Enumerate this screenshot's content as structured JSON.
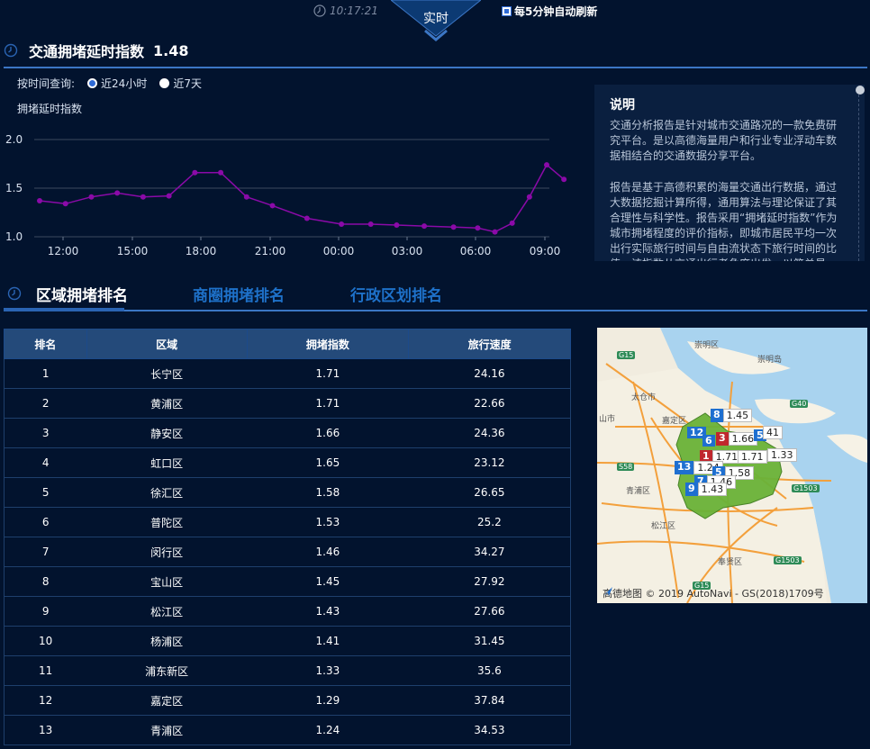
{
  "topbar": {
    "time": "10:17:21",
    "realtime_tab": "实时",
    "auto_refresh": "每5分钟自动刷新"
  },
  "index": {
    "title": "交通拥堵延时指数",
    "value": "1.48",
    "query_label": "按时间查询:",
    "options": [
      "近24小时",
      "近7天"
    ],
    "selected_option": "近24小时",
    "ylabel": "拥堵延时指数"
  },
  "chart_data": {
    "type": "line",
    "ylabel": "拥堵延时指数",
    "ylim": [
      1.0,
      2.0
    ],
    "yticks": [
      "2.0",
      "1.5",
      "1.0"
    ],
    "xticks": [
      "12:00",
      "15:00",
      "18:00",
      "21:00",
      "00:00",
      "03:00",
      "06:00",
      "09:00"
    ],
    "color": "#8b0aa8",
    "grid": true,
    "x_hours_from_start": [
      0,
      1.5,
      3,
      4.5,
      6,
      7.5,
      9,
      10.5,
      12,
      13.5,
      15.5,
      17.5,
      19.2,
      20.7,
      22.3,
      24,
      25.4,
      26.4,
      27.4,
      28.4,
      29.4,
      30.4
    ],
    "values": [
      1.37,
      1.34,
      1.41,
      1.45,
      1.41,
      1.42,
      1.66,
      1.66,
      1.41,
      1.32,
      1.19,
      1.13,
      1.13,
      1.12,
      1.11,
      1.1,
      1.09,
      1.05,
      1.14,
      1.41,
      1.74,
      1.59
    ]
  },
  "description": {
    "title": "说明",
    "p1": "交通分析报告是针对城市交通路况的一款免费研究平台。是以高德海量用户和行业专业浮动车数据相结合的交通数据分享平台。",
    "p2": "报告是基于高德积累的海量交通出行数据，通过大数据挖掘计算所得，通用算法与理论保证了其合理性与科学性。报告采用“拥堵延时指数”作为城市拥堵程度的评价指标，即城市居民平均一次出行实际旅行时间与自由流状态下旅行时间的比值。该指数从交通出行者角度出发，以简单易"
  },
  "tabs": [
    "区域拥堵排名",
    "商圈拥堵排名",
    "行政区划排名"
  ],
  "table": {
    "headers": [
      "排名",
      "区域",
      "拥堵指数",
      "旅行速度"
    ],
    "rows": [
      [
        "1",
        "长宁区",
        "1.71",
        "24.16"
      ],
      [
        "2",
        "黄浦区",
        "1.71",
        "22.66"
      ],
      [
        "3",
        "静安区",
        "1.66",
        "24.36"
      ],
      [
        "4",
        "虹口区",
        "1.65",
        "23.12"
      ],
      [
        "5",
        "徐汇区",
        "1.58",
        "26.65"
      ],
      [
        "6",
        "普陀区",
        "1.53",
        "25.2"
      ],
      [
        "7",
        "闵行区",
        "1.46",
        "34.27"
      ],
      [
        "8",
        "宝山区",
        "1.45",
        "27.92"
      ],
      [
        "9",
        "松江区",
        "1.43",
        "27.66"
      ],
      [
        "10",
        "杨浦区",
        "1.41",
        "31.45"
      ],
      [
        "11",
        "浦东新区",
        "1.33",
        "35.6"
      ],
      [
        "12",
        "嘉定区",
        "1.29",
        "37.84"
      ],
      [
        "13",
        "青浦区",
        "1.24",
        "34.53"
      ]
    ]
  },
  "map": {
    "place_labels": [
      "崇明区",
      "崇明岛",
      "太仓市",
      "嘉定区",
      "青浦区",
      "松江区",
      "奉贤区",
      "山市"
    ],
    "road_labels": [
      "G15",
      "G40",
      "S58",
      "G1503",
      "G1503",
      "G15"
    ],
    "markers": [
      {
        "n": "8",
        "v": "1.45",
        "red": false
      },
      {
        "n": "12",
        "v": "",
        "red": false
      },
      {
        "n": "6",
        "v": "",
        "red": false
      },
      {
        "n": "3",
        "v": "1.66",
        "red": true
      },
      {
        "n": "5",
        "v": "",
        "red": false
      },
      {
        "n": "",
        "v": "41",
        "red": false
      },
      {
        "n": "1",
        "v": "1.71",
        "red": true
      },
      {
        "n": "",
        "v": "1.71",
        "red": false
      },
      {
        "n": "",
        "v": "1.33",
        "red": false
      },
      {
        "n": "13",
        "v": "1.24",
        "red": false
      },
      {
        "n": "5",
        "v": "1.58",
        "red": false
      },
      {
        "n": "7",
        "v": "1.46",
        "red": false
      },
      {
        "n": "9",
        "v": "1.43",
        "red": false
      }
    ],
    "credit": "高德地图 © 2019 AutoNavi - GS(2018)1709号"
  }
}
